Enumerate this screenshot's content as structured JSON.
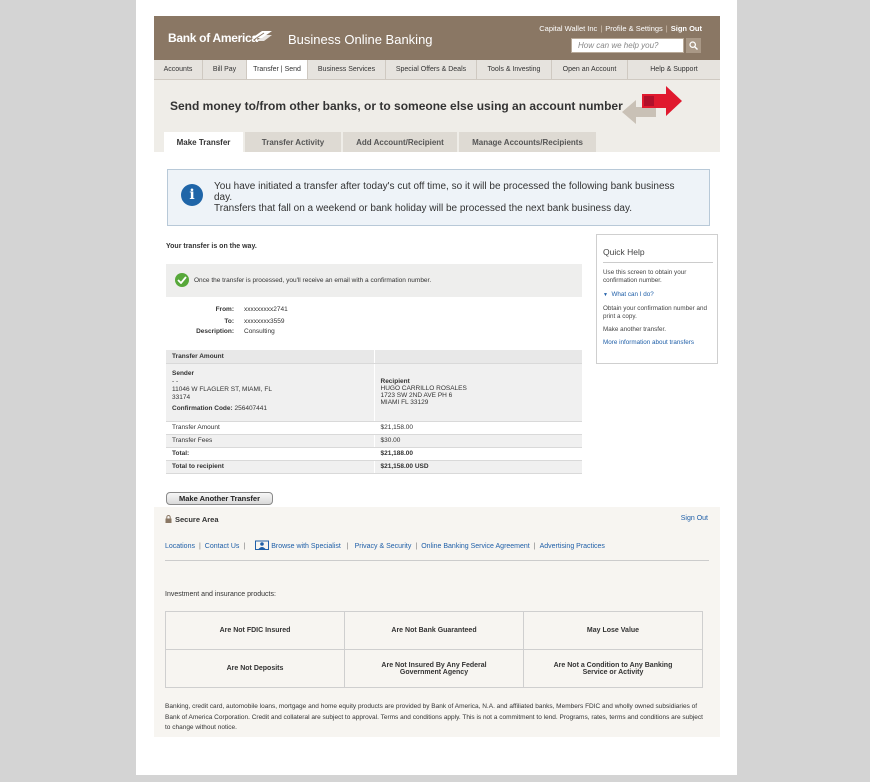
{
  "header": {
    "logo": "Bank of America",
    "product": "Business Online Banking",
    "account_name": "Capital Wallet Inc",
    "profile_link": "Profile & Settings",
    "signout_link": "Sign Out",
    "search_placeholder": "How can we help you?"
  },
  "nav": [
    "Accounts",
    "Bill Pay",
    "Transfer | Send",
    "Business Services",
    "Special Offers & Deals",
    "Tools & Investing",
    "Open an Account",
    "Help & Support"
  ],
  "banner": {
    "title": "Send money to/from other banks, or to someone else using an account number",
    "tabs": [
      "Make Transfer",
      "Transfer Activity",
      "Add Account/Recipient",
      "Manage Accounts/Recipients"
    ]
  },
  "info": {
    "line1": "You have initiated a transfer after today's cut off time, so it will be processed the following bank business day.",
    "line2": "Transfers that fall on a weekend or bank holiday will be processed the next bank business day."
  },
  "status": {
    "heading": "Your transfer is on the way.",
    "confirm_msg": "Once the transfer is processed, you'll receive an email with a confirmation number."
  },
  "details": {
    "from_label": "From:",
    "from_value": "xxxxxxxxx2741",
    "to_label": "To:",
    "to_value": "xxxxxxxx3559",
    "desc_label": "Description:",
    "desc_value": "Consulting"
  },
  "transfer_table": {
    "header": "Transfer Amount",
    "sender_label": "Sender",
    "sender_name": "- -",
    "sender_addr1": "11046 W FLAGLER ST, MIAMI, FL",
    "sender_addr2": "33174",
    "conf_label": "Confirmation Code:",
    "conf_value": "256407441",
    "recipient_label": "Recipient",
    "recipient_name": "HUGO CARRILLO ROSALES",
    "recipient_addr1": "1723 SW 2ND AVE PH 6",
    "recipient_addr2": "MIAMI FL 33129",
    "rows": [
      {
        "label": "Transfer Amount",
        "value": "$21,158.00"
      },
      {
        "label": "Transfer Fees",
        "value": "$30.00"
      },
      {
        "label": "Total:",
        "value": "$21,188.00"
      },
      {
        "label": "Total to recipient",
        "value": "$21,158.00 USD"
      }
    ]
  },
  "make_another": "Make Another Transfer",
  "quick_help": {
    "title": "Quick Help",
    "p1": "Use this screen to obtain your confirmation number.",
    "toggle": "What can I do?",
    "p2": "Obtain your confirmation number and print a copy.",
    "p3": "Make another transfer.",
    "link": "More information about transfers"
  },
  "footer": {
    "secure": "Secure Area",
    "signout": "Sign Out",
    "links": [
      "Locations",
      "Contact Us",
      "Browse with Specialist",
      "Privacy & Security",
      "Online Banking Service Agreement",
      "Advertising Practices"
    ],
    "inv_label": "Investment and insurance products:",
    "grid": [
      [
        "Are Not FDIC Insured",
        "Are Not Bank Guaranteed",
        "May Lose Value"
      ],
      [
        "Are Not Deposits",
        "Are Not Insured By Any Federal Government Agency",
        "Are Not a Condition to Any Banking Service or Activity"
      ]
    ],
    "disclaimer": "Banking, credit card, automobile loans, mortgage and home equity products are provided by Bank of America, N.A. and affiliated banks, Members FDIC and wholly owned subsidiaries of Bank of America Corporation. Credit and collateral are subject to approval. Terms and conditions apply. This is not a commitment to lend. Programs, rates, terms and conditions are subject to change without notice."
  },
  "colors": {
    "header_bg": "#8a7764",
    "link": "#1f5fa8",
    "info_icon": "#1f65a8",
    "check": "#57a83a",
    "arrow_red": "#e0192e"
  }
}
